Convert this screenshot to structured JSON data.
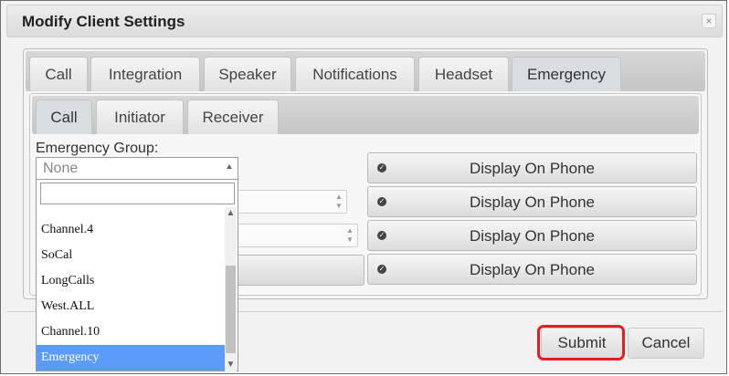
{
  "dialog": {
    "title": "Modify Client Settings",
    "close_icon": "×"
  },
  "tabs": [
    {
      "label": "Call"
    },
    {
      "label": "Integration"
    },
    {
      "label": "Speaker"
    },
    {
      "label": "Notifications"
    },
    {
      "label": "Headset"
    },
    {
      "label": "Emergency",
      "active": true
    }
  ],
  "subtabs": [
    {
      "label": "Call",
      "active": true
    },
    {
      "label": "Initiator"
    },
    {
      "label": "Receiver"
    }
  ],
  "emergency_group": {
    "label": "Emergency Group:",
    "selected": "None",
    "search_value": "",
    "options": [
      {
        "label": "Channel.5",
        "partially_visible": true
      },
      {
        "label": "Channel.4"
      },
      {
        "label": "SoCal"
      },
      {
        "label": "LongCalls"
      },
      {
        "label": "West.ALL"
      },
      {
        "label": "Channel.10"
      },
      {
        "label": "Emergency",
        "highlighted": true
      }
    ]
  },
  "hidden_button_label_fragment": "l",
  "display_buttons": [
    {
      "label": "Display On Phone",
      "icon": "check-circle-icon"
    },
    {
      "label": "Display On Phone",
      "icon": "check-circle-icon"
    },
    {
      "label": "Display On Phone",
      "icon": "check-circle-icon"
    },
    {
      "label": "Display On Phone",
      "icon": "check-circle-icon"
    }
  ],
  "footer": {
    "submit_label": "Submit",
    "cancel_label": "Cancel"
  },
  "colors": {
    "highlight": "#5b9cf8",
    "submit_outline": "#e41e24"
  }
}
